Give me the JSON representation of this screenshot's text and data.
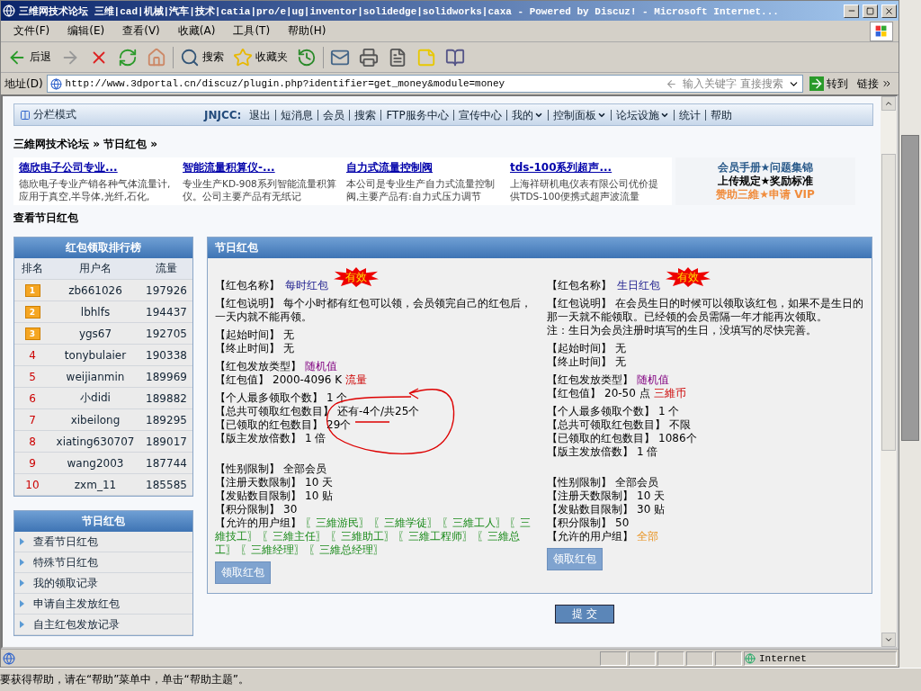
{
  "window": {
    "title": "三维网技术论坛 三维|cad|机械|汽车|技术|catia|pro/e|ug|inventor|solidedge|solidworks|caxa - Powered by Discuz! - Microsoft Internet..."
  },
  "menu": [
    "文件(F)",
    "编辑(E)",
    "查看(V)",
    "收藏(A)",
    "工具(T)",
    "帮助(H)"
  ],
  "toolbar": [
    {
      "kind": "back",
      "label": "后退"
    },
    {
      "kind": "forward"
    },
    {
      "kind": "stop"
    },
    {
      "kind": "refresh"
    },
    {
      "kind": "home"
    },
    {
      "kind": "search",
      "label": "搜索"
    },
    {
      "kind": "favorites",
      "label": "收藏夹"
    },
    {
      "kind": "history"
    },
    {
      "kind": "mail"
    },
    {
      "kind": "print"
    },
    {
      "kind": "edit"
    },
    {
      "kind": "note"
    },
    {
      "kind": "research"
    }
  ],
  "address": {
    "label": "地址(D)",
    "url": "http://www.3dportal.cn/discuz/plugin.php?identifier=get_money&module=money",
    "search_placeholder": "输入关键字 直接搜索",
    "go": "转到",
    "links": "链接"
  },
  "nav": {
    "mode": "分栏模式",
    "site": "JNJCC:",
    "items": [
      {
        "label": "退出",
        "dropdown": false
      },
      {
        "label": "短消息",
        "dropdown": false
      },
      {
        "label": "会员",
        "dropdown": false
      },
      {
        "label": "搜索",
        "dropdown": false
      },
      {
        "label": "FTP服务中心",
        "dropdown": false
      },
      {
        "label": "宣传中心",
        "dropdown": false
      },
      {
        "label": "我的",
        "dropdown": true
      },
      {
        "label": "控制面板",
        "dropdown": true
      },
      {
        "label": "论坛设施",
        "dropdown": true
      },
      {
        "label": "统计",
        "dropdown": false
      },
      {
        "label": "帮助",
        "dropdown": false
      }
    ]
  },
  "breadcrumb": "三維网技术论坛 » 节日红包 »",
  "ads": [
    {
      "title": "德欣电子公司专业...",
      "text": "德欣电子专业产销各种气体流量计,应用于真空,半导体,光纤,石化,"
    },
    {
      "title": "智能流量积算仪-...",
      "text": "专业生产KD-908系列智能流量积算仪。公司主要产品有无纸记"
    },
    {
      "title": "自力式流量控制阀",
      "text": "本公司是专业生产自力式流量控制阀,主要产品有:自力式压力调节"
    },
    {
      "title": "tds-100系列超声...",
      "text": "上海祥研机电仪表有限公司优价提供TDS-100便携式超声波流量"
    }
  ],
  "side_links": [
    {
      "text": "会员手册★问题集锦",
      "color": "#2a5a8a"
    },
    {
      "text": "上传规定★奖励标准",
      "color": "#000000"
    },
    {
      "text": "赞助三維★申请 VIP",
      "color": "#f08c3c"
    }
  ],
  "page_heading": "查看节日红包",
  "ranking": {
    "title": "红包领取排行榜",
    "columns": [
      "排名",
      "用户名",
      "流量"
    ],
    "rows": [
      {
        "rank": "1",
        "kind": "medal",
        "user": "zb661026",
        "flow": "197926"
      },
      {
        "rank": "2",
        "kind": "medal",
        "user": "lbhlfs",
        "flow": "194437"
      },
      {
        "rank": "3",
        "kind": "medal",
        "user": "ygs67",
        "flow": "192705"
      },
      {
        "rank": "4",
        "kind": "plain",
        "user": "tonybulaier",
        "flow": "190338"
      },
      {
        "rank": "5",
        "kind": "plain",
        "user": "weijianmin",
        "flow": "189969"
      },
      {
        "rank": "6",
        "kind": "plain",
        "user": "小didi",
        "flow": "189882"
      },
      {
        "rank": "7",
        "kind": "plain",
        "user": "xibeilong",
        "flow": "189295"
      },
      {
        "rank": "8",
        "kind": "plain",
        "user": "xiating630707",
        "flow": "189017"
      },
      {
        "rank": "9",
        "kind": "plain",
        "user": "wang2003",
        "flow": "187744"
      },
      {
        "rank": "10",
        "kind": "plain",
        "user": "zxm_11",
        "flow": "185585"
      }
    ]
  },
  "menu_card": {
    "title": "节日红包",
    "items": [
      "查看节日红包",
      "特殊节日红包",
      "我的领取记录",
      "申请自主发放红包",
      "自主红包发放记录"
    ]
  },
  "main": {
    "title": "节日红包",
    "packets": [
      {
        "name_label": "【红包名称】",
        "name": "每时红包",
        "status": "有效",
        "annotated": true,
        "description": [
          "【红包说明】 每个小时都有红包可以领，会员领完自己的红包后，一天内就不能再领。"
        ],
        "groups": [
          [
            {
              "label": "【起始时间】",
              "value": "无",
              "kind": "plain"
            },
            {
              "label": "【终止时间】",
              "value": "无",
              "kind": "plain"
            }
          ],
          [
            {
              "label": "【红包发放类型】",
              "value": "随机值",
              "kind": "type"
            },
            {
              "label": "【红包值】",
              "value": "2000-4096 K",
              "unit": "流量",
              "kind": "amount"
            }
          ],
          [
            {
              "label": "【个人最多领取个数】",
              "value": "1 个",
              "kind": "plain"
            },
            {
              "label": "【总共可领取红包数目】",
              "value": "还有-4个/共25个",
              "kind": "plain"
            },
            {
              "label": "【已领取的红包数目】",
              "value": "29个",
              "kind": "plain"
            },
            {
              "label": "【版主发放倍数】",
              "value": "1 倍",
              "kind": "plain"
            }
          ],
          [
            {
              "label": "【性别限制】",
              "value": "全部会员",
              "kind": "plain"
            },
            {
              "label": "【注册天数限制】",
              "value": "10 天",
              "kind": "plain"
            },
            {
              "label": "【发贴数目限制】",
              "value": "10 贴",
              "kind": "plain"
            },
            {
              "label": "【积分限制】",
              "value": "30",
              "kind": "plain"
            },
            {
              "label": "【允许的用户组】",
              "value": "〖三維游民〗 〖三維学徒〗 〖三維工人〗 〖三維技工〗 〖三維主任〗 〖三維助工〗 〖三維工程师〗 〖三維总工〗 〖三維经理〗 〖三維总经理〗",
              "kind": "group"
            }
          ]
        ],
        "button": "领取红包"
      },
      {
        "name_label": "【红包名称】",
        "name": "生日红包",
        "status": "有效",
        "annotated": false,
        "description": [
          "【红包说明】 在会员生日的时候可以领取该红包，如果不是生日的那一天就不能领取。已经领的会员需隔一年才能再次领取。",
          "注：生日为会员注册时填写的生日，没填写的尽快完善。"
        ],
        "groups": [
          [
            {
              "label": "【起始时间】",
              "value": "无",
              "kind": "plain"
            },
            {
              "label": "【终止时间】",
              "value": "无",
              "kind": "plain"
            }
          ],
          [
            {
              "label": "【红包发放类型】",
              "value": "随机值",
              "kind": "type"
            },
            {
              "label": "【红包值】",
              "value": "20-50 点",
              "unit": "三維币",
              "kind": "amount"
            }
          ],
          [
            {
              "label": "【个人最多领取个数】",
              "value": "1 个",
              "kind": "plain"
            },
            {
              "label": "【总共可领取红包数目】",
              "value": "不限",
              "kind": "plain"
            },
            {
              "label": "【已领取的红包数目】",
              "value": "1086个",
              "kind": "plain"
            },
            {
              "label": "【版主发放倍数】",
              "value": "1 倍",
              "kind": "plain"
            }
          ],
          [
            {
              "label": "【性别限制】",
              "value": "全部会员",
              "kind": "plain"
            },
            {
              "label": "【注册天数限制】",
              "value": "10 天",
              "kind": "plain"
            },
            {
              "label": "【发贴数目限制】",
              "value": "30 贴",
              "kind": "plain"
            },
            {
              "label": "【积分限制】",
              "value": "50",
              "kind": "plain"
            },
            {
              "label": "【允许的用户组】",
              "value": "全部",
              "kind": "all"
            }
          ]
        ],
        "button": "领取红包"
      }
    ]
  },
  "submit": "提 交",
  "browser_status": {
    "zone": "Internet"
  },
  "help_status": "要获得帮助，请在“帮助”菜单中，单击“帮助主题”。"
}
